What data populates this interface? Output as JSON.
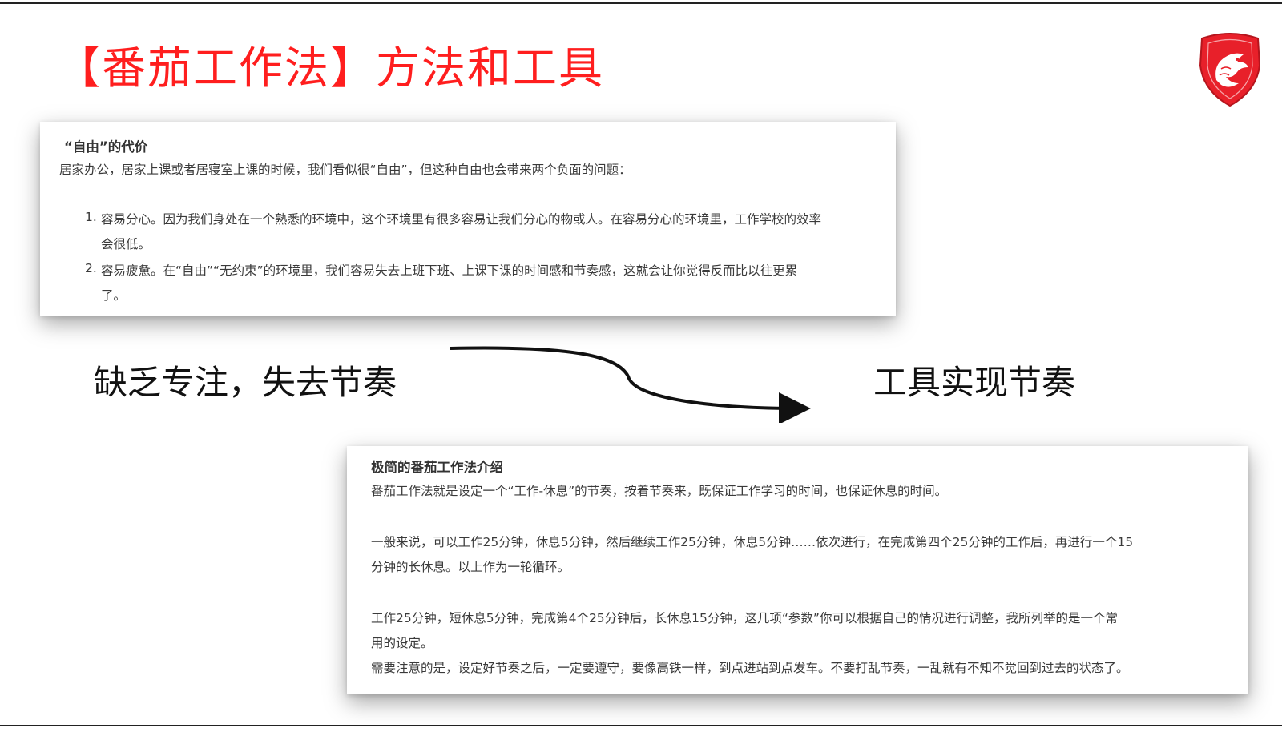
{
  "title": "【番茄工作法】方法和工具",
  "logo_icon": "msi-dragon-shield-icon",
  "card1": {
    "heading": "“自由”的代价",
    "intro": "居家办公，居家上课或者居寝室上课的时候，我们看似很“自由”，但这种自由也会带来两个负面的问题：",
    "items": [
      {
        "number": "1.",
        "lines": [
          "容易分心。因为我们身处在一个熟悉的环境中，这个环境里有很多容易让我们分心的物或人。在容易分心的环境里，工作学校的效率",
          "会很低。"
        ]
      },
      {
        "number": "2.",
        "lines": [
          "容易疲惫。在“自由”“无约束”的环境里，我们容易失去上班下班、上课下课的时间感和节奏感，这就会让你觉得反而比以往更累",
          "了。"
        ]
      }
    ]
  },
  "left_label": "缺乏专注，失去节奏",
  "right_label": "工具实现节奏",
  "card2": {
    "heading": "极简的番茄工作法介绍",
    "lines": [
      "番茄工作法就是设定一个“工作-休息”的节奏，按着节奏来，既保证工作学习的时间，也保证休息的时间。",
      "一般来说，可以工作25分钟，休息5分钟，然后继续工作25分钟，休息5分钟……依次进行，在完成第四个25分钟的工作后，再进行一个15",
      "分钟的长休息。以上作为一轮循环。",
      "工作25分钟，短休息5分钟，完成第4个25分钟后，长休息15分钟，这几项“参数”你可以根据自己的情况进行调整，我所列举的是一个常",
      "用的设定。",
      "需要注意的是，设定好节奏之后，一定要遵守，要像高铁一样，到点进站到点发车。不要打乱节奏，一乱就有不知不觉回到过去的状态了。"
    ]
  },
  "colors": {
    "title": "#ff1e1e",
    "logo_red": "#e8202a",
    "text": "#3a3a3a"
  }
}
